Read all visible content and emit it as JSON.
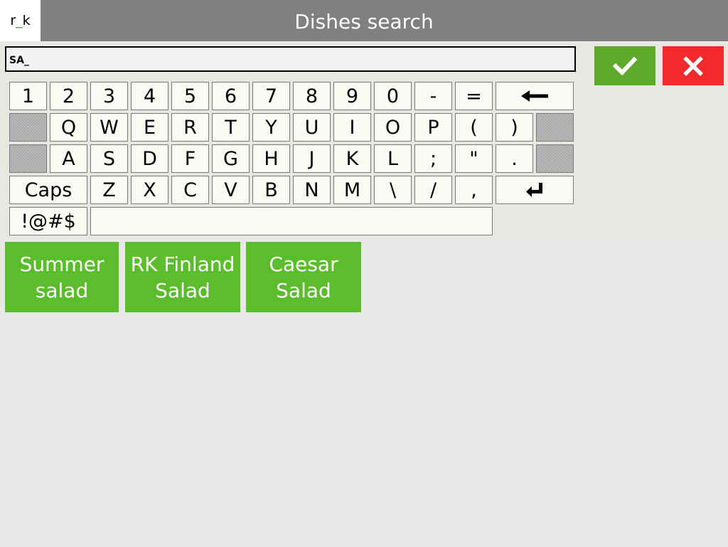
{
  "header": {
    "logo_prefix": "r",
    "logo_separator": "_",
    "logo_suffix": "k",
    "title": "Dishes search"
  },
  "search": {
    "value": "SA_"
  },
  "actions": {
    "ok_icon": "checkmark-icon",
    "cancel_icon": "cross-icon"
  },
  "keyboard": {
    "row1": [
      "1",
      "2",
      "3",
      "4",
      "5",
      "6",
      "7",
      "8",
      "9",
      "0",
      "-",
      "="
    ],
    "backspace_icon": "backspace-arrow-icon",
    "row2": [
      "Q",
      "W",
      "E",
      "R",
      "T",
      "Y",
      "U",
      "I",
      "O",
      "P",
      "(",
      ")"
    ],
    "row3": [
      "A",
      "S",
      "D",
      "F",
      "G",
      "H",
      "J",
      "K",
      "L",
      ";",
      "\"",
      "."
    ],
    "caps_label": "Caps",
    "row4": [
      "Z",
      "X",
      "C",
      "V",
      "B",
      "N",
      "M",
      "\\",
      "/",
      ","
    ],
    "enter_icon": "enter-arrow-icon",
    "symbols_label": "!@#$"
  },
  "dishes": [
    {
      "name": "Summer\nsalad"
    },
    {
      "name": "RK Finland\nSalad"
    },
    {
      "name": "Caesar\nSalad"
    }
  ],
  "colors": {
    "header_bg": "#808080",
    "ok_green": "#5ea82a",
    "cancel_red": "#f02a2d",
    "dish_green": "#5bbc2c"
  }
}
